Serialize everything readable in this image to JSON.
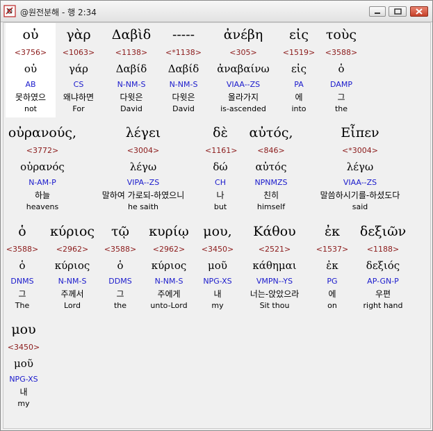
{
  "window": {
    "title": "@원전분해 - 행 2:34",
    "icon": "app-icon"
  },
  "words": [
    {
      "greek": "οὐ",
      "strong": "<3756>",
      "lemma": "οὐ",
      "parse": "AB",
      "korean": "못하였으",
      "english": "not"
    },
    {
      "greek": "γὰρ",
      "strong": "<1063>",
      "lemma": "γάρ",
      "parse": "CS",
      "korean": "왜냐하면",
      "english": "For"
    },
    {
      "greek": "Δαβὶδ",
      "strong": "<1138>",
      "lemma": "Δαβίδ",
      "parse": "N-NM-S",
      "korean": "다윗은",
      "english": "David"
    },
    {
      "greek": "-----",
      "strong": "<*1138>",
      "lemma": "Δαβίδ",
      "parse": "N-NM-S",
      "korean": "다윗은",
      "english": "David"
    },
    {
      "greek": "ἀνέβη",
      "strong": "<305>",
      "lemma": "ἀναβαίνω",
      "parse": "VIAA--ZS",
      "korean": "올라가지",
      "english": "is-ascended"
    },
    {
      "greek": "εἰς",
      "strong": "<1519>",
      "lemma": "εἰς",
      "parse": "PA",
      "korean": "에",
      "english": "into"
    },
    {
      "greek": "τοὺς",
      "strong": "<3588>",
      "lemma": "ὁ",
      "parse": "DAMP",
      "korean": "그",
      "english": "the"
    },
    {
      "greek": "οὐρανούς,",
      "strong": "<3772>",
      "lemma": "οὐρανός",
      "parse": "N-AM-P",
      "korean": "하늘",
      "english": "heavens"
    },
    {
      "greek": "λέγει",
      "strong": "<3004>",
      "lemma": "λέγω",
      "parse": "VIPA--ZS",
      "korean": "말하여 가로되-하였으니",
      "english": "he saith"
    },
    {
      "greek": "δὲ",
      "strong": "<1161>",
      "lemma": "δώ",
      "parse": "CH",
      "korean": "나",
      "english": "but"
    },
    {
      "greek": "αὐτός,",
      "strong": "<846>",
      "lemma": "αὐτός",
      "parse": "NPNMZS",
      "korean": "친히",
      "english": "himself"
    },
    {
      "greek": "Εἶπεν",
      "strong": "<*3004>",
      "lemma": "λέγω",
      "parse": "VIAA--ZS",
      "korean": "말씀하시기를-하셨도다",
      "english": "said"
    },
    {
      "greek": "ὁ",
      "strong": "<3588>",
      "lemma": "ὁ",
      "parse": "DNMS",
      "korean": "그",
      "english": "The"
    },
    {
      "greek": "κύριος",
      "strong": "<2962>",
      "lemma": "κύριος",
      "parse": "N-NM-S",
      "korean": "주께서",
      "english": "Lord"
    },
    {
      "greek": "τῷ",
      "strong": "<3588>",
      "lemma": "ὁ",
      "parse": "DDMS",
      "korean": "그",
      "english": "the"
    },
    {
      "greek": "κυρίῳ",
      "strong": "<2962>",
      "lemma": "κύριος",
      "parse": "N-NM-S",
      "korean": "주에게",
      "english": "unto-Lord"
    },
    {
      "greek": "μου,",
      "strong": "<3450>",
      "lemma": "μοῦ",
      "parse": "NPG-XS",
      "korean": "내",
      "english": "my"
    },
    {
      "greek": "Κάθου",
      "strong": "<2521>",
      "lemma": "κάθημαι",
      "parse": "VMPN--YS",
      "korean": "너는-앉았으라",
      "english": "Sit thou"
    },
    {
      "greek": "ἐκ",
      "strong": "<1537>",
      "lemma": "ἐκ",
      "parse": "PG",
      "korean": "에",
      "english": "on"
    },
    {
      "greek": "δεξιῶν",
      "strong": "<1188>",
      "lemma": "δεξιός",
      "parse": "AP-GN-P",
      "korean": "우편",
      "english": "right hand"
    },
    {
      "greek": "μου",
      "strong": "<3450>",
      "lemma": "μοῦ",
      "parse": "NPG-XS",
      "korean": "내",
      "english": "my"
    }
  ]
}
